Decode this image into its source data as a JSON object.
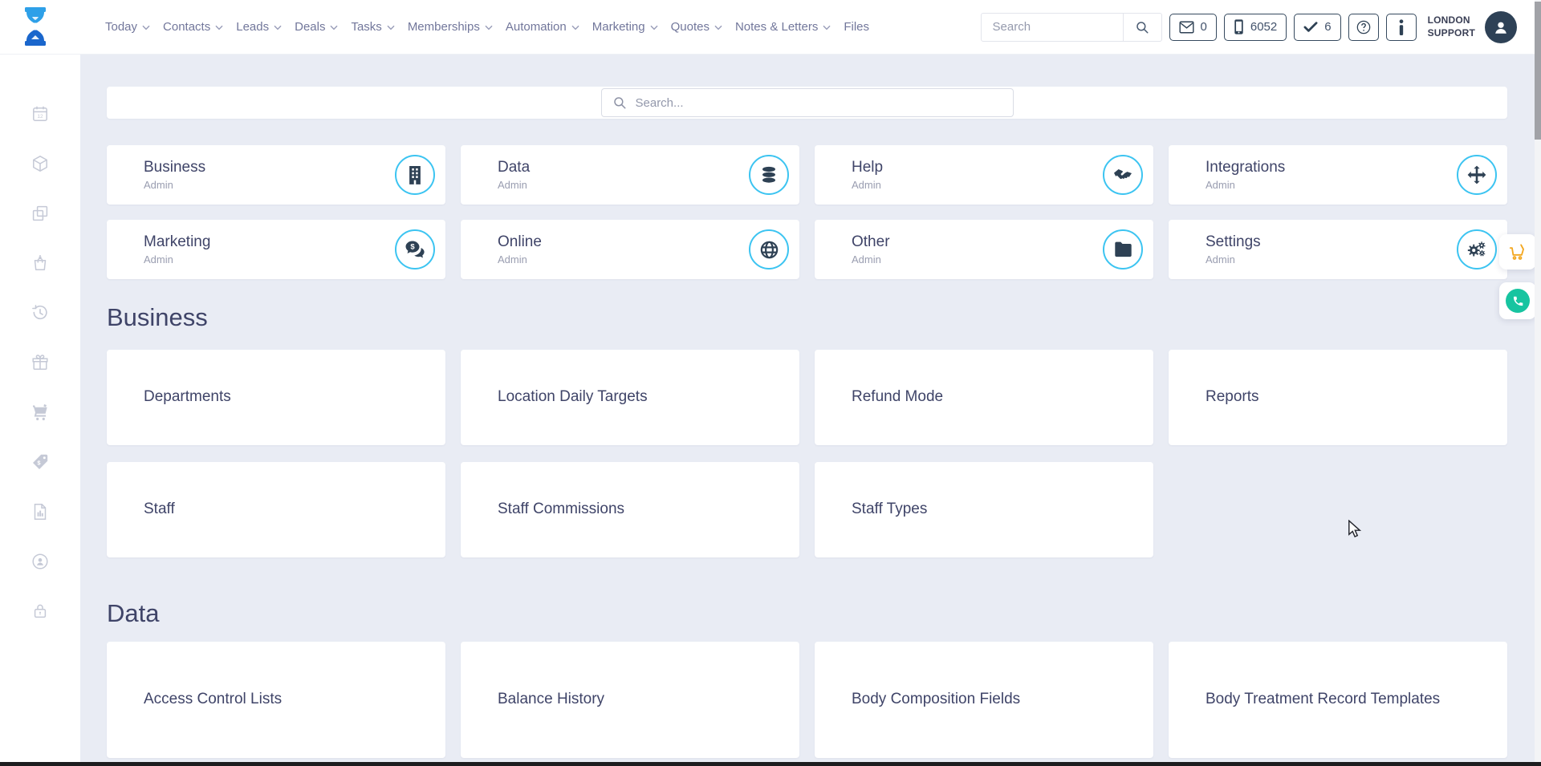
{
  "colors": {
    "page_bg": "#e9ecf4",
    "accent_ring": "#3cc4f1",
    "navy": "#2e4154",
    "title_text": "#3f4468",
    "muted_text": "#999db0",
    "cart_orange": "#f3a71f",
    "chat_green": "#17c4a0"
  },
  "header": {
    "nav": [
      {
        "label": "Today",
        "chevron": true
      },
      {
        "label": "Contacts",
        "chevron": true
      },
      {
        "label": "Leads",
        "chevron": true
      },
      {
        "label": "Deals",
        "chevron": true
      },
      {
        "label": "Tasks",
        "chevron": true
      },
      {
        "label": "Memberships",
        "chevron": true
      },
      {
        "label": "Automation",
        "chevron": true
      },
      {
        "label": "Marketing",
        "chevron": true
      },
      {
        "label": "Quotes",
        "chevron": true
      },
      {
        "label": "Notes & Letters",
        "chevron": true
      },
      {
        "label": "Files",
        "chevron": false
      }
    ],
    "search": {
      "placeholder": "Search"
    },
    "stats": [
      {
        "icon": "envelope-icon",
        "value": "0"
      },
      {
        "icon": "mobile-icon",
        "value": "6052"
      },
      {
        "icon": "check-icon",
        "value": "6"
      }
    ],
    "icon_buttons": [
      {
        "icon": "question-icon"
      },
      {
        "icon": "info-icon"
      }
    ],
    "user": {
      "line1": "LONDON",
      "line2": "SUPPORT",
      "avatar_icon": "person-icon"
    },
    "logo_icon": "hourglass-logo"
  },
  "sidebar": {
    "items": [
      "calendar-icon",
      "cube-icon",
      "copy-icon",
      "bag-in-icon",
      "history-icon",
      "gift-icon",
      "cart-filled-icon",
      "price-tag-icon",
      "report-icon",
      "user-circle-icon",
      "lock-icon"
    ]
  },
  "main": {
    "search": {
      "placeholder": "Search..."
    },
    "categories": [
      {
        "title": "Business",
        "subtitle": "Admin",
        "icon": "building-icon"
      },
      {
        "title": "Data",
        "subtitle": "Admin",
        "icon": "database-icon"
      },
      {
        "title": "Help",
        "subtitle": "Admin",
        "icon": "handshake-icon"
      },
      {
        "title": "Integrations",
        "subtitle": "Admin",
        "icon": "arrows-move-icon"
      },
      {
        "title": "Marketing",
        "subtitle": "Admin",
        "icon": "comments-dollar-icon"
      },
      {
        "title": "Online",
        "subtitle": "Admin",
        "icon": "globe-icon"
      },
      {
        "title": "Other",
        "subtitle": "Admin",
        "icon": "folder-icon"
      },
      {
        "title": "Settings",
        "subtitle": "Admin",
        "icon": "cogs-icon"
      }
    ],
    "sections": [
      {
        "title": "Business",
        "items": [
          "Departments",
          "Location Daily Targets",
          "Refund Mode",
          "Reports",
          "Staff",
          "Staff Commissions",
          "Staff Types"
        ]
      },
      {
        "title": "Data",
        "items": [
          "Access Control Lists",
          "Balance History",
          "Body Composition Fields",
          "Body Treatment Record Templates"
        ]
      }
    ]
  },
  "floating": [
    {
      "icon": "cart-outline-icon"
    },
    {
      "icon": "phone-icon"
    }
  ]
}
